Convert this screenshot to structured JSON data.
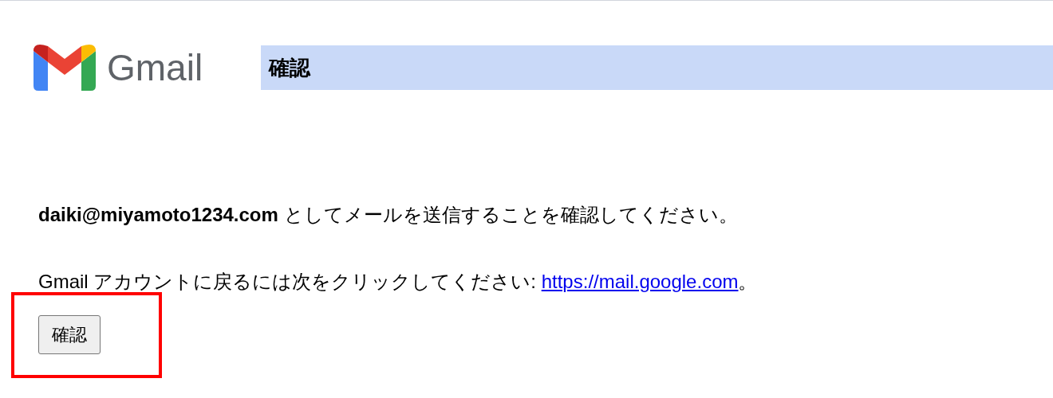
{
  "logo": {
    "wordmark": "Gmail"
  },
  "header": {
    "title": "確認"
  },
  "message": "**daiki@miyamoto1234.com** としてメールを送信することを確認してください。",
  "return_note": {
    "text": "Gmail アカウントに戻るには次をクリックしてください: ",
    "link": "https://mail.google.com",
    "suffix": "。"
  },
  "button": {
    "label": "確認"
  }
}
